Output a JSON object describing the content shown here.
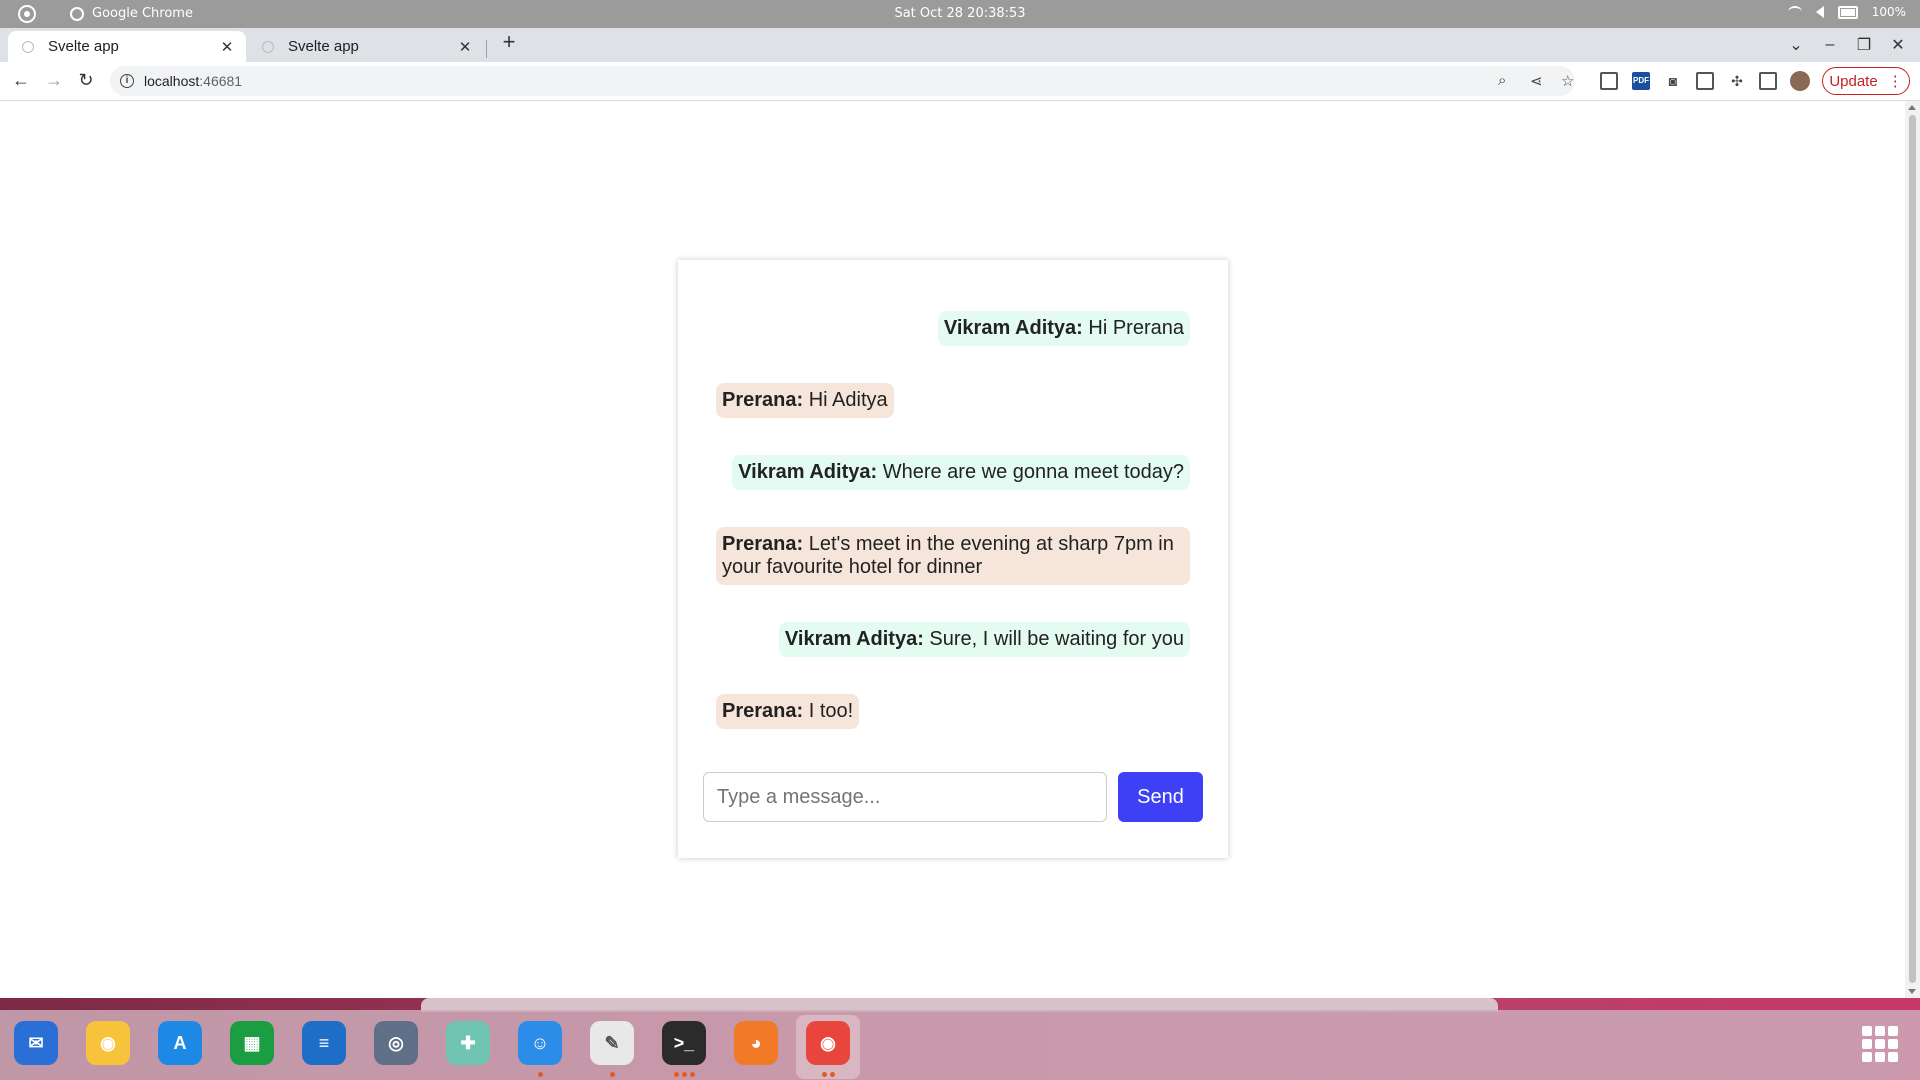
{
  "os_bar": {
    "app_name": "Google Chrome",
    "clock": "Sat Oct 28  20:38:53",
    "battery": "100%"
  },
  "browser": {
    "tabs": [
      {
        "label": "Svelte app",
        "active": true
      },
      {
        "label": "Svelte app",
        "active": false
      }
    ],
    "url_host": "localhost",
    "url_port": ":46681",
    "update_label": "Update"
  },
  "chat": {
    "messages": [
      {
        "sender": "Vikram Aditya:",
        "text": " Hi Prerana",
        "side": "me"
      },
      {
        "sender": "Prerana:",
        "text": " Hi Aditya",
        "side": "them"
      },
      {
        "sender": "Vikram Aditya:",
        "text": " Where are we gonna meet today?",
        "side": "me"
      },
      {
        "sender": "Prerana:",
        "text": " Let's meet in the evening at sharp 7pm in your favourite hotel for dinner",
        "side": "them"
      },
      {
        "sender": "Vikram Aditya:",
        "text": " Sure, I will be waiting for you",
        "side": "me"
      },
      {
        "sender": "Prerana:",
        "text": " I too!",
        "side": "them"
      }
    ],
    "input_placeholder": "Type a message...",
    "input_value": "",
    "send_label": "Send"
  },
  "dock": {
    "items": [
      {
        "name": "thunderbird-icon",
        "color": "#2a6fd6",
        "glyph": "✉",
        "dots": 0
      },
      {
        "name": "rhythmbox-icon",
        "color": "#f6c33a",
        "glyph": "◉",
        "dots": 0
      },
      {
        "name": "app-center-icon",
        "color": "#1e88e5",
        "glyph": "A",
        "dots": 0
      },
      {
        "name": "calc-icon",
        "color": "#1b9d42",
        "glyph": "▦",
        "dots": 0
      },
      {
        "name": "writer-icon",
        "color": "#1e6ec8",
        "glyph": "≡",
        "dots": 0
      },
      {
        "name": "screenshot-icon",
        "color": "#5f6f87",
        "glyph": "◎",
        "dots": 0
      },
      {
        "name": "help-icon",
        "color": "#6fc4b2",
        "glyph": "✚",
        "dots": 0
      },
      {
        "name": "finder-icon",
        "color": "#2c8de8",
        "glyph": "☺",
        "dots": 1
      },
      {
        "name": "text-editor-icon",
        "color": "#e8e8e8",
        "glyph": "✎",
        "dots": 1
      },
      {
        "name": "terminal-icon",
        "color": "#2b2b2b",
        "glyph": ">_",
        "dots": 3
      },
      {
        "name": "firefox-icon",
        "color": "#f27a26",
        "glyph": "◕",
        "dots": 0
      },
      {
        "name": "chrome-icon",
        "color": "#e8453c",
        "glyph": "◉",
        "dots": 2
      }
    ]
  }
}
